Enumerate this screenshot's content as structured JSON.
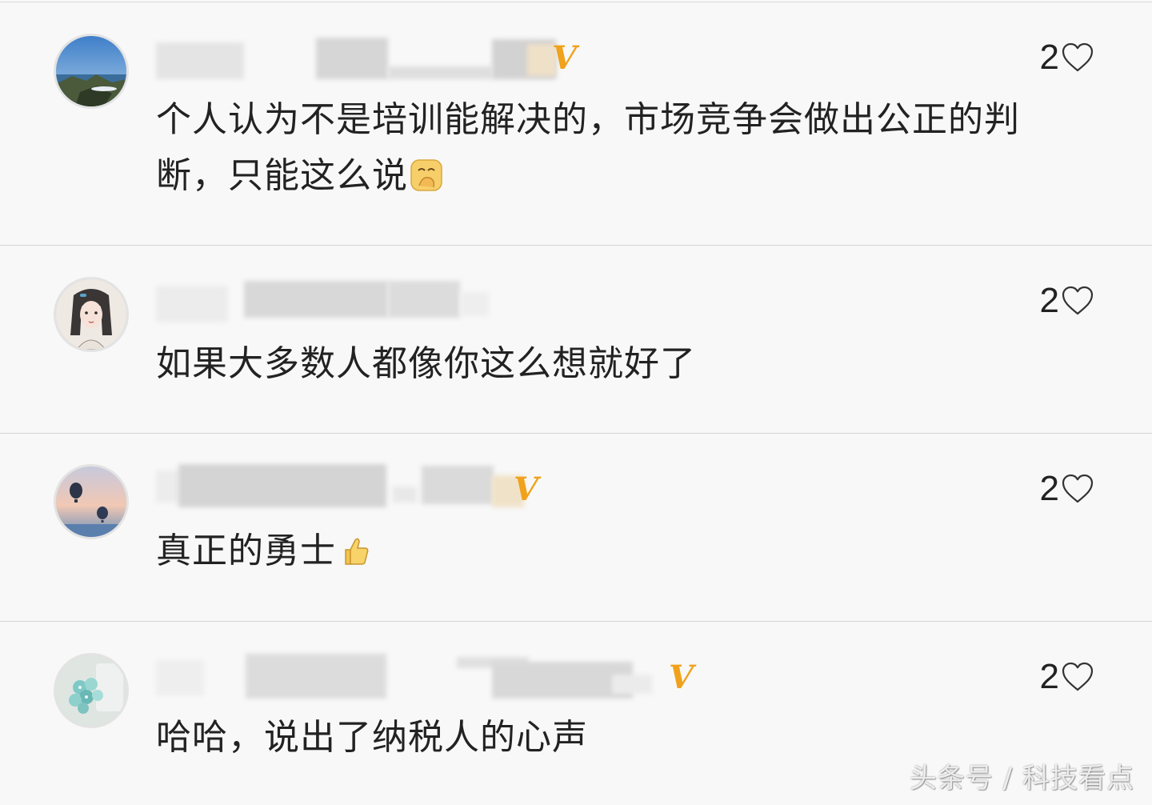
{
  "comments": [
    {
      "avatar": "coastal-landscape-avatar",
      "verified": true,
      "likes": "2",
      "text": "个人认为不是培训能解决的，市场竞争会做出公正的判断，只能这么说",
      "emoji": "face-with-hand-over-mouth"
    },
    {
      "avatar": "illustrated-girl-avatar",
      "verified": false,
      "likes": "2",
      "text": "如果大多数人都像你这么想就好了",
      "emoji": ""
    },
    {
      "avatar": "hot-air-balloons-avatar",
      "verified": true,
      "likes": "2",
      "text": "真正的勇士",
      "emoji": "thumbs-up"
    },
    {
      "avatar": "flowers-avatar",
      "verified": true,
      "likes": "2",
      "text": "哈哈，说出了纳税人的心声",
      "emoji": ""
    }
  ],
  "verified_mark": "V",
  "watermark": "头条号 / 科技看点",
  "colors": {
    "verified": "#f0a21c",
    "text": "#222222",
    "background": "#f8f8f8",
    "divider": "#d3d3d3"
  }
}
